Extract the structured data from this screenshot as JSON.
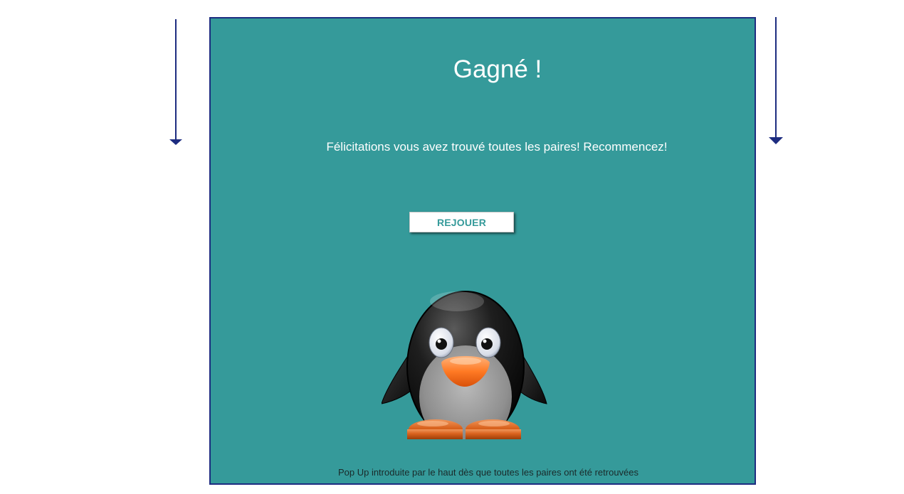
{
  "popup": {
    "title": "Gagné !",
    "message": "Félicitations vous avez trouvé toutes les paires! Recommencez!",
    "replay_label": "REJOUER",
    "footer_note": "Pop Up introduite par le haut dès que toutes les paires ont été retrouvées",
    "mascot_icon": "penguin-illustration",
    "background_color": "#359a9a",
    "border_color": "#1d2c80"
  },
  "arrows": [
    {
      "icon": "arrow-down-icon",
      "color": "#1d2c80"
    },
    {
      "icon": "arrow-down-icon",
      "color": "#1d2c80"
    }
  ]
}
